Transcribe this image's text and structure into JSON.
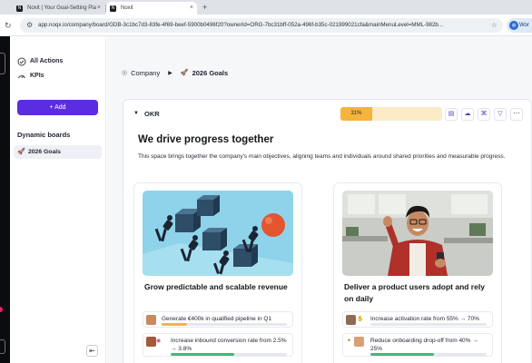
{
  "browser": {
    "tabs": [
      {
        "label": "Noxit | Your Goal-Setting Pla",
        "active": false
      },
      {
        "label": "Noxit",
        "active": true
      }
    ],
    "new_tab": "+",
    "url": "app.noqx.io/company/board/GDB-3c1bc7d3-83fe-4f69-beef-5900b0496f20?ownerId=ORG-7bc31bff-052a-496f-b35c-021999021cfa&mainMenuLevel=MML-982b...",
    "profile_label": "Wor"
  },
  "sidebar": {
    "items": [
      {
        "label": "All Actions",
        "icon": "check-circle-icon"
      },
      {
        "label": "KPIs",
        "icon": "gauge-icon"
      }
    ],
    "add_button": "+ Add",
    "section_title": "Dynamic boards",
    "boards": [
      {
        "label": "2026 Goals",
        "icon": "rocket-icon"
      }
    ]
  },
  "breadcrumb": {
    "root": "Company",
    "current": "2026 Goals"
  },
  "okr": {
    "label": "OKR",
    "progress_text": "31%",
    "progress_value": 0.31,
    "toolbar_icons": [
      "comment-icon",
      "cloud-upload-icon",
      "org-chart-icon",
      "filter-icon",
      "more-icon"
    ]
  },
  "hero": {
    "title": "We drive progress together",
    "description": "This space brings together the company's main objectives, aligning teams and individuals around shared priorities and measurable progress."
  },
  "objectives": [
    {
      "title": "Grow predictable and scalable revenue",
      "key_results": [
        {
          "text": "Generate €400k in qualified pipeline in Q1",
          "progress": 0.2,
          "color": "#f5b43b"
        },
        {
          "text": "Increase inbound conversion rate from 2.5% → 3.8%",
          "progress": 0.55,
          "color": "#3dbb78"
        }
      ]
    },
    {
      "title": "Deliver a product users adopt and rely on daily",
      "key_results": [
        {
          "text": "Increase activation rate from 55% → 70%",
          "progress": 0.0,
          "color": "#3dbb78"
        },
        {
          "text": "Reduce onboarding drop-off from 40% → 25%",
          "progress": 0.55,
          "color": "#3dbb78"
        }
      ]
    }
  ],
  "colors": {
    "accent": "#5b2de0",
    "progress_fill": "#f5b43b",
    "progress_track": "#fbecc7",
    "success": "#3dbb78"
  }
}
